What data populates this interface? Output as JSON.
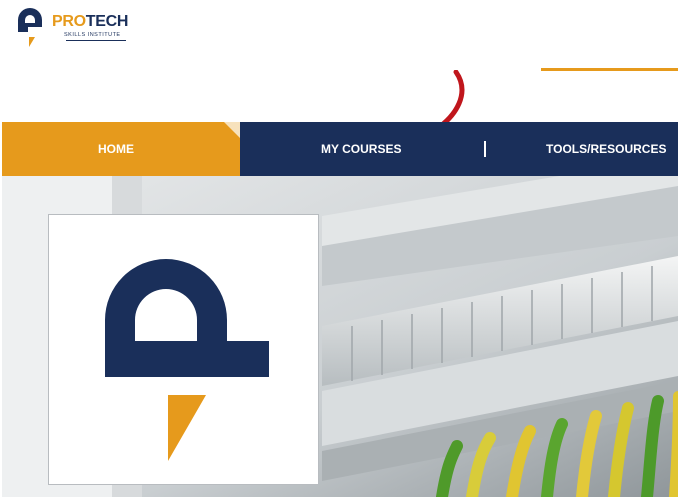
{
  "header": {
    "logo": {
      "brand_pro": "PRO",
      "brand_tech": "TECH",
      "tagline": "SKILLS INSTITUTE"
    }
  },
  "nav": {
    "items": [
      {
        "label": "HOME",
        "active": true
      },
      {
        "label": "MY COURSES",
        "active": false
      },
      {
        "label": "TOOLS/RESOURCES",
        "active": false
      }
    ]
  },
  "annotation": {
    "icon": "red-arrow-icon",
    "points_to": "MY COURSES"
  },
  "hero": {
    "image": "electrical-panel-wiring",
    "card_icon": "protech-logo-mark-icon"
  },
  "colors": {
    "navy": "#1a2f5a",
    "orange": "#e69a1c",
    "annotation_red": "#c0161c"
  }
}
